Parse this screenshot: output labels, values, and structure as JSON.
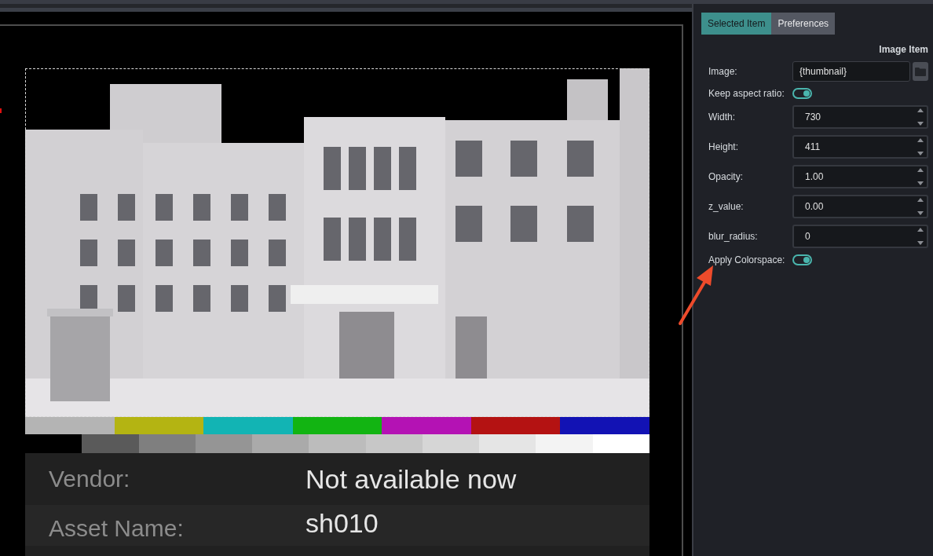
{
  "color_bars": [
    {
      "color": "#b4b4b4"
    },
    {
      "color": "#b4b412"
    },
    {
      "color": "#12b4b4"
    },
    {
      "color": "#12b412"
    },
    {
      "color": "#b412b4"
    },
    {
      "color": "#b41212"
    },
    {
      "color": "#1212b4"
    }
  ],
  "tone_steps": [
    {
      "color": "#5a5a5a"
    },
    {
      "color": "#7f7f7f"
    },
    {
      "color": "#959595"
    },
    {
      "color": "#aaaaaa"
    },
    {
      "color": "#bcbcbc"
    },
    {
      "color": "#c7c7c7"
    },
    {
      "color": "#d6d6d6"
    },
    {
      "color": "#e5e5e5"
    },
    {
      "color": "#f3f3f3"
    },
    {
      "color": "#ffffff"
    }
  ],
  "info_table": {
    "rows": [
      {
        "label": "Vendor:",
        "value": "Not available now"
      },
      {
        "label": "Asset Name:",
        "value": "sh010"
      }
    ]
  },
  "tabs": [
    {
      "label": "Selected Item",
      "selected": true
    },
    {
      "label": "Preferences",
      "selected": false
    }
  ],
  "panel": {
    "title": "Image Item",
    "fields": [
      {
        "kind": "file",
        "label": "Image:",
        "value": "{thumbnail}"
      },
      {
        "kind": "toggle",
        "label": "Keep aspect ratio:",
        "on": true
      },
      {
        "kind": "spin",
        "label": "Width:",
        "value": "730"
      },
      {
        "kind": "spin",
        "label": "Height:",
        "value": "411"
      },
      {
        "kind": "spin",
        "label": "Opacity:",
        "value": "1.00"
      },
      {
        "kind": "spin",
        "label": "z_value:",
        "value": "0.00"
      },
      {
        "kind": "spin",
        "label": "blur_radius:",
        "value": "0"
      },
      {
        "kind": "toggle",
        "label": "Apply Colorspace:",
        "on": true
      }
    ]
  }
}
